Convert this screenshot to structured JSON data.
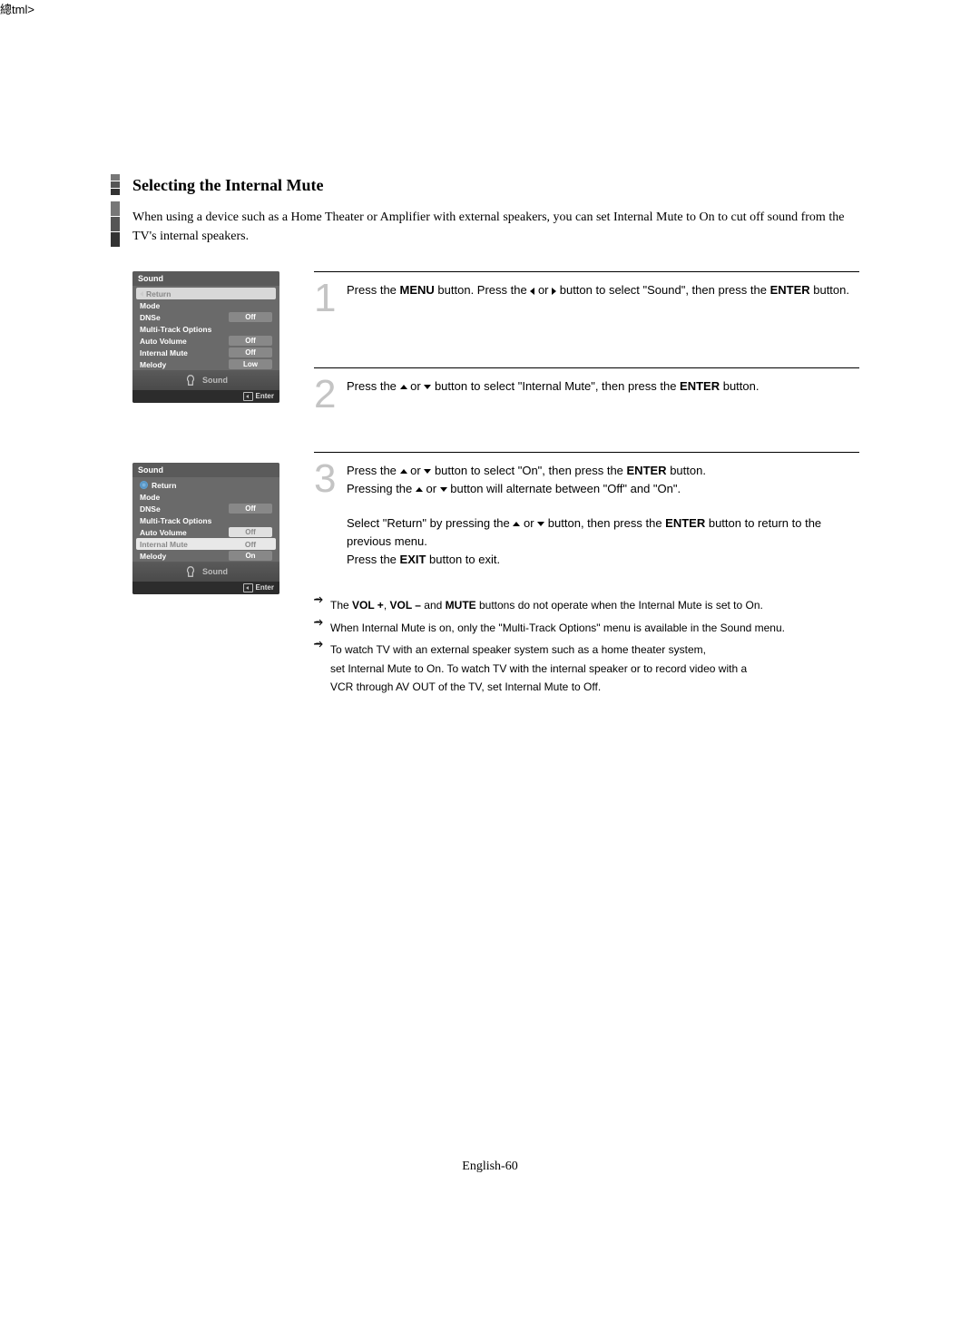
{
  "title": "Selecting the Internal Mute",
  "intro": "When using a device such as a Home Theater or Amplifier with external speakers, you can set Internal Mute to On to cut off sound from the TV's internal speakers.",
  "page_footer": "English-60",
  "osd1": {
    "header": "Sound",
    "return": "Return",
    "rows": [
      {
        "label": "Mode",
        "val": ""
      },
      {
        "label": "DNSe",
        "val": "Off"
      },
      {
        "label": "Multi-Track Options",
        "val": ""
      },
      {
        "label": "Auto Volume",
        "val": "Off"
      },
      {
        "label": "Internal Mute",
        "val": "Off"
      },
      {
        "label": "Melody",
        "val": "Low"
      }
    ],
    "footer": "Sound",
    "enter": "Enter"
  },
  "osd2": {
    "header": "Sound",
    "return": "Return",
    "rows": [
      {
        "label": "Mode",
        "val": ""
      },
      {
        "label": "DNSe",
        "val": "Off"
      },
      {
        "label": "Multi-Track Options",
        "val": ""
      },
      {
        "label": "Auto Volume",
        "val": ""
      },
      {
        "label": "Internal Mute",
        "val": "Off"
      },
      {
        "label": "Melody",
        "val": "On"
      }
    ],
    "popup": "Off",
    "footer": "Sound",
    "enter": "Enter"
  },
  "steps": {
    "s1_a": "Press the ",
    "s1_menu": "MENU",
    "s1_b": " button. Press the ",
    "s1_c": " or ",
    "s1_d": " button to select \"Sound\", then press the ",
    "s1_enter": "ENTER",
    "s1_e": " button.",
    "s2_a": "Press the ",
    "s2_b": " or ",
    "s2_c": " button to select \"Internal Mute\", then press the ",
    "s2_enter": "ENTER",
    "s2_d": " button.",
    "s3_a": "Press the ",
    "s3_b": " or ",
    "s3_c": " button to select \"On\", then press the ",
    "s3_enter": "ENTER",
    "s3_d": " button.",
    "s3_e": "Pressing the ",
    "s3_f": " or ",
    "s3_g": " button will alternate between \"Off\" and \"On\".",
    "s3_h": "Select \"Return\" by pressing the ",
    "s3_i": " or ",
    "s3_j": " button, then press the ",
    "s3_enter2": "ENTER",
    "s3_k": " button to return to the previous menu.",
    "s3_l": "Press the ",
    "s3_exit": "EXIT",
    "s3_m": " button to exit."
  },
  "notes": {
    "n1_a": "The ",
    "n1_b": "VOL +",
    "n1_c": ", ",
    "n1_d": "VOL –",
    "n1_e": " and ",
    "n1_f": "MUTE",
    "n1_g": " buttons do not operate when the Internal Mute is set to On.",
    "n2": "When Internal Mute is on, only the \"Multi-Track Options\" menu is available in the Sound menu.",
    "n3a": "To watch TV with an external speaker system such as a home theater system,",
    "n3b": "set Internal Mute to On. To watch TV with the internal speaker or to record video with a",
    "n3c": "VCR through AV OUT of the TV, set Internal Mute to Off."
  }
}
